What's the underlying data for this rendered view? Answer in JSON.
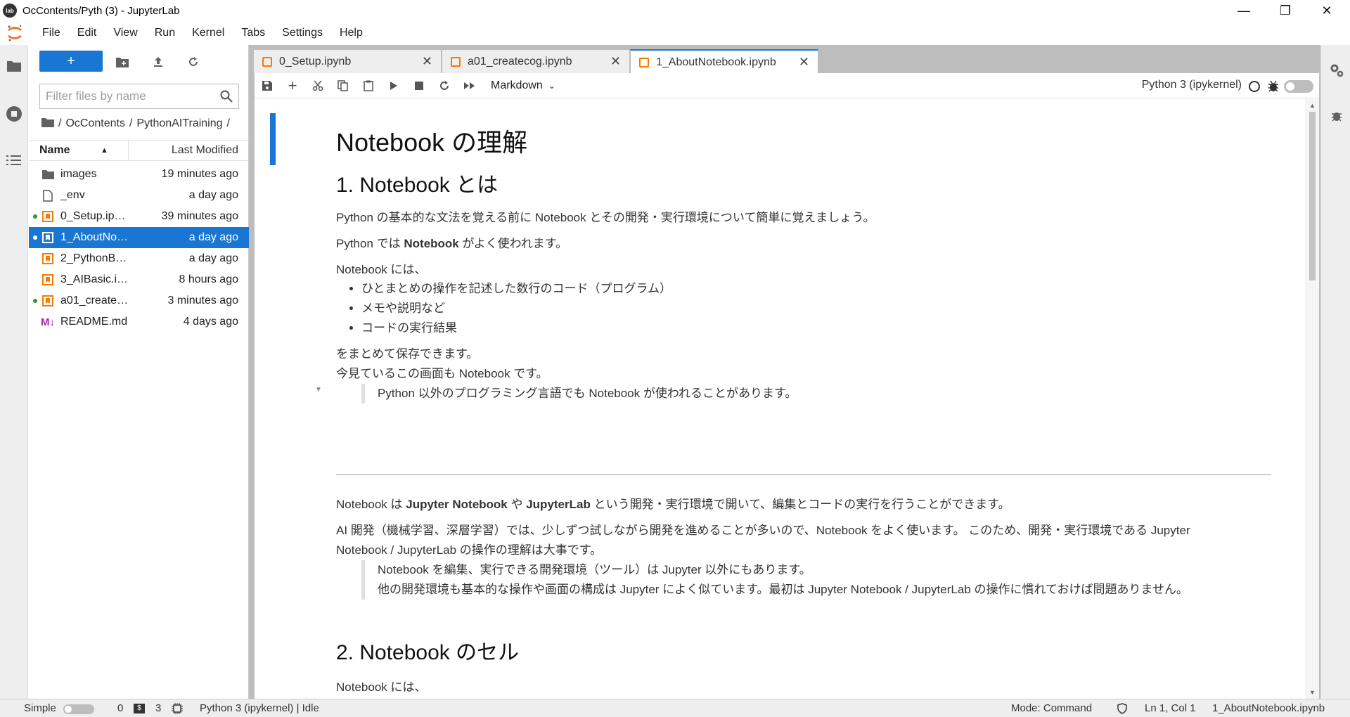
{
  "window": {
    "title": "OcContents/Pyth (3) - JupyterLab",
    "logo_text": "lab"
  },
  "menu": [
    "File",
    "Edit",
    "View",
    "Run",
    "Kernel",
    "Tabs",
    "Settings",
    "Help"
  ],
  "filebrowser": {
    "new_button": "+",
    "filter_placeholder": "Filter files by name",
    "breadcrumb": [
      "/",
      "OcContents",
      "/",
      "PythonAITraining",
      "/"
    ],
    "header": {
      "name": "Name",
      "modified": "Last Modified"
    },
    "files": [
      {
        "name": "images",
        "modified": "19 minutes ago",
        "type": "folder",
        "running": false,
        "selected": false
      },
      {
        "name": "_env",
        "modified": "a day ago",
        "type": "file",
        "running": false,
        "selected": false
      },
      {
        "name": "0_Setup.ipy…",
        "modified": "39 minutes ago",
        "type": "notebook",
        "running": true,
        "selected": false
      },
      {
        "name": "1_AboutNo…",
        "modified": "a day ago",
        "type": "notebook",
        "running": true,
        "selected": true
      },
      {
        "name": "2_PythonB…",
        "modified": "a day ago",
        "type": "notebook",
        "running": false,
        "selected": false
      },
      {
        "name": "3_AIBasic.i…",
        "modified": "8 hours ago",
        "type": "notebook",
        "running": false,
        "selected": false
      },
      {
        "name": "a01_create…",
        "modified": "3 minutes ago",
        "type": "notebook",
        "running": true,
        "selected": false
      },
      {
        "name": "README.md",
        "modified": "4 days ago",
        "type": "markdown",
        "running": false,
        "selected": false
      }
    ]
  },
  "tabs": [
    {
      "label": "0_Setup.ipynb",
      "active": false
    },
    {
      "label": "a01_createcog.ipynb",
      "active": false
    },
    {
      "label": "1_AboutNotebook.ipynb",
      "active": true
    }
  ],
  "notebook_toolbar": {
    "cell_type": "Markdown",
    "kernel": "Python 3 (ipykernel)"
  },
  "content": {
    "h1": "Notebook の理解",
    "h2_1": "1. Notebook とは",
    "p1": "Python の基本的な文法を覚える前に Notebook とその開発・実行環境について簡単に覚えましょう。",
    "p2_pre": "Python では ",
    "p2_bold": "Notebook",
    "p2_post": " がよく使われます。",
    "p3": "Notebook には、",
    "bullets": [
      "ひとまとめの操作を記述した数行のコード（プログラム）",
      "メモや説明など",
      "コードの実行結果"
    ],
    "p4a": "をまとめて保存できます。",
    "p4b": "今見ているこの画面も Notebook です。",
    "quote1": "Python 以外のプログラミング言語でも Notebook が使われることがあります。",
    "p5_a": "Notebook は ",
    "p5_b1": "Jupyter Notebook",
    "p5_c": " や ",
    "p5_b2": "JupyterLab",
    "p5_d": " という開発・実行環境で開いて、編集とコードの実行を行うことができます。",
    "p6a": "AI 開発（機械学習、深層学習）では、少しずつ試しながら開発を進めることが多いので、Notebook をよく使います。 このため、開発・実行環境である Jupyter",
    "p6b": "Notebook / JupyterLab の操作の理解は大事です。",
    "quote2a": "Notebook を編集、実行できる開発環境（ツール）は Jupyter 以外にもあります。",
    "quote2b": "他の開発環境も基本的な操作や画面の構成は Jupyter によく似ています。最初は Jupyter Notebook / JupyterLab の操作に慣れておけば問題ありません。",
    "h2_2": "2. Notebook のセル",
    "p7": "Notebook には、"
  },
  "status": {
    "simple": "Simple",
    "terminals": "0",
    "kernels": "3",
    "kernel_status": "Python 3 (ipykernel) | Idle",
    "mode": "Mode: Command",
    "position": "Ln 1, Col 1",
    "file": "1_AboutNotebook.ipynb"
  },
  "colors": {
    "accent": "#1976d2",
    "notebook_icon": "#f57c00",
    "running": "#388e3c",
    "markdown_icon": "#9c27b0"
  }
}
